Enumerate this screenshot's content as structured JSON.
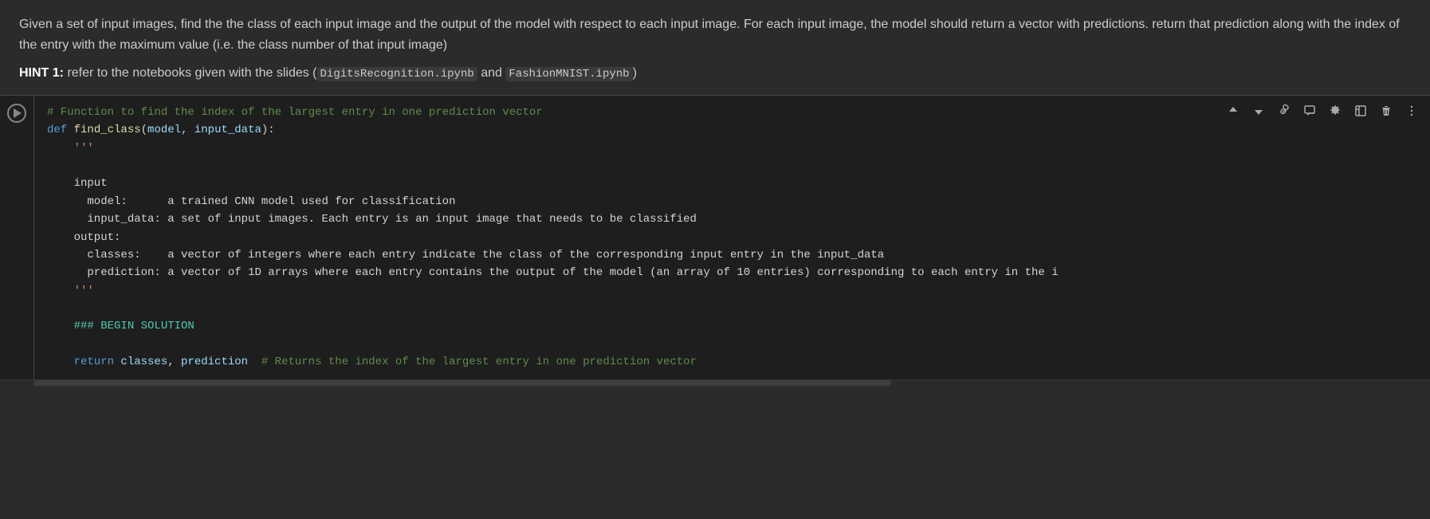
{
  "description": {
    "paragraph": "Given a set of input images, find the the class of each input image and the output of the model with respect to each input image. For each input image, the model should return a vector with predictions. return that prediction along with the index of the entry with the maximum value (i.e. the class number of that input image)",
    "hint_label": "HINT 1:",
    "hint_text": " refer to the notebooks given with the slides (",
    "hint_code1": "DigitsRecognition.ipynb",
    "hint_and": " and ",
    "hint_code2": "FashionMNIST.ipynb",
    "hint_close": ")"
  },
  "toolbar": {
    "up_icon": "↑",
    "down_icon": "↓",
    "link_icon": "🔗",
    "note_icon": "📄",
    "gear_icon": "⚙",
    "expand_icon": "⤢",
    "trash_icon": "🗑",
    "more_icon": "⋮"
  },
  "code": {
    "lines": [
      {
        "type": "comment",
        "text": "# Function to find the index of the largest entry in one prediction vector"
      },
      {
        "type": "def",
        "text": "def find_class(model, input_data):"
      },
      {
        "type": "docstring",
        "text": "    '''"
      },
      {
        "type": "blank",
        "text": ""
      },
      {
        "type": "normal",
        "text": "    input"
      },
      {
        "type": "normal",
        "text": "      model:      a trained CNN model used for classification"
      },
      {
        "type": "normal",
        "text": "      input_data: a set of input images. Each entry is an input image that needs to be classified"
      },
      {
        "type": "normal",
        "text": "    output:"
      },
      {
        "type": "normal",
        "text": "      classes:    a vector of integers where each entry indicate the class of the corresponding input entry in the input_data"
      },
      {
        "type": "normal",
        "text": "      prediction: a vector of 1D arrays where each entry contains the output of the model (an array of 10 entries) corresponding to each entry in the i"
      },
      {
        "type": "docstring",
        "text": "    '''"
      },
      {
        "type": "blank",
        "text": ""
      },
      {
        "type": "section",
        "text": "    ### BEGIN SOLUTION"
      },
      {
        "type": "blank",
        "text": ""
      },
      {
        "type": "return",
        "text": "    return classes, prediction  # Returns the index of the largest entry in one prediction vector"
      }
    ]
  }
}
